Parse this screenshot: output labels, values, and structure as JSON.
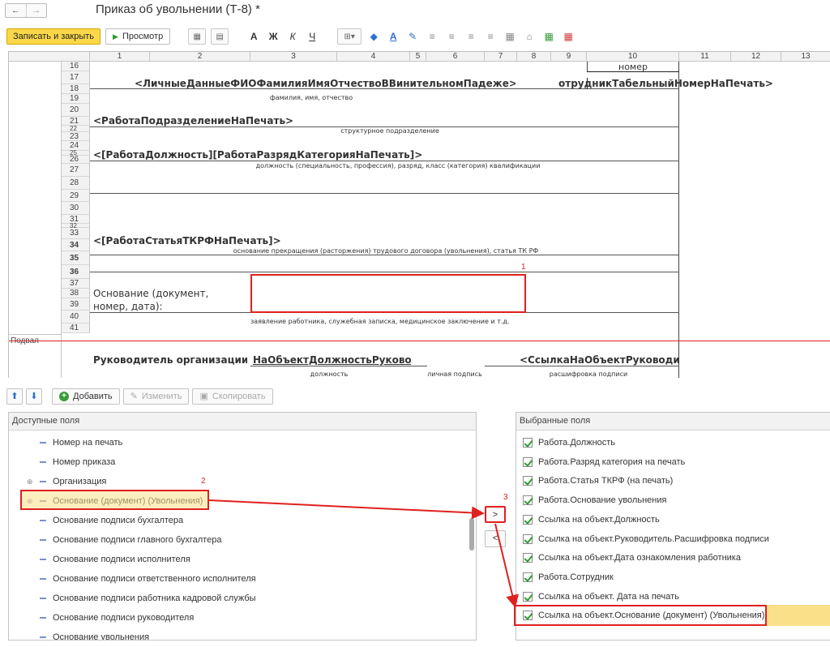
{
  "window": {
    "title": "Приказ об увольнении (Т-8) *",
    "nav_back": "←",
    "nav_forward": "→"
  },
  "toolbar": {
    "save_close": "Записать и закрыть",
    "preview": "Просмотр",
    "bold": "А",
    "bold2": "Ж",
    "italic": "К",
    "underline": "Ч"
  },
  "sheet": {
    "columns": [
      "1",
      "2",
      "3",
      "4",
      "5",
      "6",
      "7",
      "8",
      "9",
      "10",
      "11",
      "12",
      "13"
    ],
    "rows": [
      "16",
      "17",
      "18",
      "19",
      "20",
      "21",
      "22",
      "23",
      "24",
      "25",
      "26",
      "27",
      "28",
      "29",
      "30",
      "31",
      "32",
      "33",
      "34",
      "35",
      "36",
      "37",
      "38",
      "39",
      "40",
      "41"
    ],
    "section_label": "Подвал",
    "nomer": "номер",
    "row17_text": "<ЛичныеДанныеФИОФамилияИмяОтчествоВВинительномПадеже>",
    "row17_right": "отрудникТабельныйНомерНаПечать>",
    "row18_caption": "фамилия, имя, отчество",
    "row20_text": "<РаботаПодразделениеНаПечать>",
    "row21_caption": "структурное подразделение",
    "row23_text": "<[РаботаДолжность][РаботаРазрядКатегорияНаПечать]>",
    "row24_caption": "должность (специальность, профессия), разряд, класс (категория) квалификации",
    "row30_text": "<[РаботаСтатьяТКРФНаПечать]>",
    "row31_caption": "основание прекращения (расторжения) трудового договора (увольнения), статья ТК РФ",
    "row35_text": "Основание (документ,",
    "row36_text": "номер, дата):",
    "row37_caption": "заявление работника, служебная записка, медицинское заключение и т.д.",
    "row40_a": "Руководитель организации",
    "row40_b": "НаОбъектДолжностьРуково",
    "row40_c": "<СсылкаНаОбъектРуководи",
    "row41_a": "должность",
    "row41_b": "личная подпись",
    "row41_c": "расшифровка подписи",
    "marker1": "1"
  },
  "lower_toolbar": {
    "up": "⬆",
    "down": "⬇",
    "add": "Добавить",
    "edit": "Изменить",
    "copy": "Скопировать"
  },
  "available": {
    "header": "Доступные поля",
    "items": [
      "Номер на печать",
      "Номер приказа",
      "Организация",
      "Основание (документ) (Увольнения)",
      "Основание подписи бухгалтера",
      "Основание подписи главного бухгалтера",
      "Основание подписи исполнителя",
      "Основание подписи ответственного исполнителя",
      "Основание подписи работника кадровой службы",
      "Основание подписи руководителя",
      "Основание увольнения"
    ],
    "marker2": "2"
  },
  "move": {
    "add": ">",
    "remove": "<",
    "marker3": "3"
  },
  "selected": {
    "header": "Выбранные поля",
    "items": [
      "Работа.Должность",
      "Работа.Разряд категория на печать",
      "Работа.Статья ТКРФ (на печать)",
      "Работа.Основание увольнения",
      "Ссылка на объект.Должность",
      "Ссылка на объект.Руководитель.Расшифровка подписи",
      "Ссылка на объект.Дата ознакомления работника",
      "Работа.Сотрудник",
      "Ссылка на объект. Дата на печать",
      "Ссылка на объект.Основание (документ) (Увольнения)"
    ]
  },
  "colors": {
    "accent_yellow": "#fbd84a",
    "highlight": "#fbe08a",
    "annotation_red": "#e02020"
  }
}
